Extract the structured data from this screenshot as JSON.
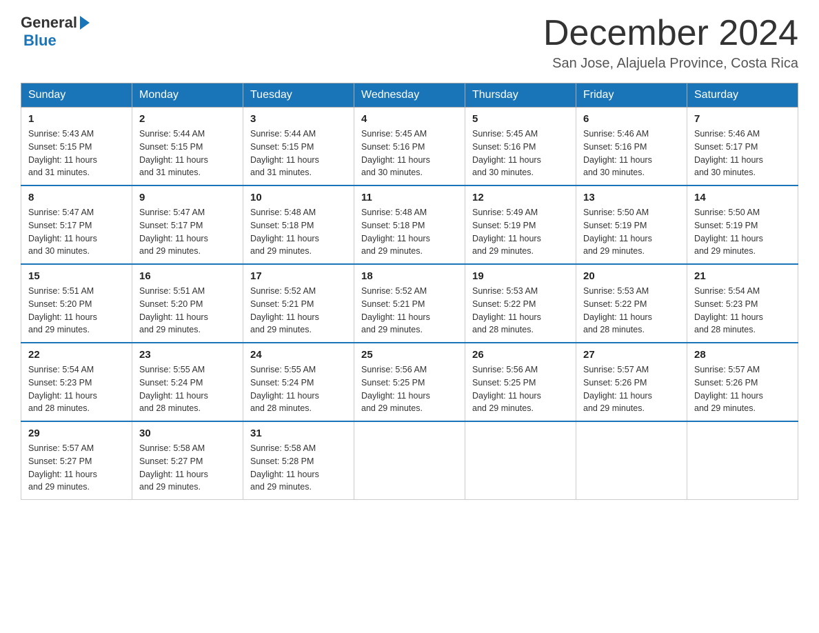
{
  "logo": {
    "general": "General",
    "blue": "Blue"
  },
  "title": "December 2024",
  "location": "San Jose, Alajuela Province, Costa Rica",
  "days_of_week": [
    "Sunday",
    "Monday",
    "Tuesday",
    "Wednesday",
    "Thursday",
    "Friday",
    "Saturday"
  ],
  "weeks": [
    [
      {
        "day": "1",
        "sunrise": "5:43 AM",
        "sunset": "5:15 PM",
        "daylight": "11 hours and 31 minutes."
      },
      {
        "day": "2",
        "sunrise": "5:44 AM",
        "sunset": "5:15 PM",
        "daylight": "11 hours and 31 minutes."
      },
      {
        "day": "3",
        "sunrise": "5:44 AM",
        "sunset": "5:15 PM",
        "daylight": "11 hours and 31 minutes."
      },
      {
        "day": "4",
        "sunrise": "5:45 AM",
        "sunset": "5:16 PM",
        "daylight": "11 hours and 30 minutes."
      },
      {
        "day": "5",
        "sunrise": "5:45 AM",
        "sunset": "5:16 PM",
        "daylight": "11 hours and 30 minutes."
      },
      {
        "day": "6",
        "sunrise": "5:46 AM",
        "sunset": "5:16 PM",
        "daylight": "11 hours and 30 minutes."
      },
      {
        "day": "7",
        "sunrise": "5:46 AM",
        "sunset": "5:17 PM",
        "daylight": "11 hours and 30 minutes."
      }
    ],
    [
      {
        "day": "8",
        "sunrise": "5:47 AM",
        "sunset": "5:17 PM",
        "daylight": "11 hours and 30 minutes."
      },
      {
        "day": "9",
        "sunrise": "5:47 AM",
        "sunset": "5:17 PM",
        "daylight": "11 hours and 29 minutes."
      },
      {
        "day": "10",
        "sunrise": "5:48 AM",
        "sunset": "5:18 PM",
        "daylight": "11 hours and 29 minutes."
      },
      {
        "day": "11",
        "sunrise": "5:48 AM",
        "sunset": "5:18 PM",
        "daylight": "11 hours and 29 minutes."
      },
      {
        "day": "12",
        "sunrise": "5:49 AM",
        "sunset": "5:19 PM",
        "daylight": "11 hours and 29 minutes."
      },
      {
        "day": "13",
        "sunrise": "5:50 AM",
        "sunset": "5:19 PM",
        "daylight": "11 hours and 29 minutes."
      },
      {
        "day": "14",
        "sunrise": "5:50 AM",
        "sunset": "5:19 PM",
        "daylight": "11 hours and 29 minutes."
      }
    ],
    [
      {
        "day": "15",
        "sunrise": "5:51 AM",
        "sunset": "5:20 PM",
        "daylight": "11 hours and 29 minutes."
      },
      {
        "day": "16",
        "sunrise": "5:51 AM",
        "sunset": "5:20 PM",
        "daylight": "11 hours and 29 minutes."
      },
      {
        "day": "17",
        "sunrise": "5:52 AM",
        "sunset": "5:21 PM",
        "daylight": "11 hours and 29 minutes."
      },
      {
        "day": "18",
        "sunrise": "5:52 AM",
        "sunset": "5:21 PM",
        "daylight": "11 hours and 29 minutes."
      },
      {
        "day": "19",
        "sunrise": "5:53 AM",
        "sunset": "5:22 PM",
        "daylight": "11 hours and 28 minutes."
      },
      {
        "day": "20",
        "sunrise": "5:53 AM",
        "sunset": "5:22 PM",
        "daylight": "11 hours and 28 minutes."
      },
      {
        "day": "21",
        "sunrise": "5:54 AM",
        "sunset": "5:23 PM",
        "daylight": "11 hours and 28 minutes."
      }
    ],
    [
      {
        "day": "22",
        "sunrise": "5:54 AM",
        "sunset": "5:23 PM",
        "daylight": "11 hours and 28 minutes."
      },
      {
        "day": "23",
        "sunrise": "5:55 AM",
        "sunset": "5:24 PM",
        "daylight": "11 hours and 28 minutes."
      },
      {
        "day": "24",
        "sunrise": "5:55 AM",
        "sunset": "5:24 PM",
        "daylight": "11 hours and 28 minutes."
      },
      {
        "day": "25",
        "sunrise": "5:56 AM",
        "sunset": "5:25 PM",
        "daylight": "11 hours and 29 minutes."
      },
      {
        "day": "26",
        "sunrise": "5:56 AM",
        "sunset": "5:25 PM",
        "daylight": "11 hours and 29 minutes."
      },
      {
        "day": "27",
        "sunrise": "5:57 AM",
        "sunset": "5:26 PM",
        "daylight": "11 hours and 29 minutes."
      },
      {
        "day": "28",
        "sunrise": "5:57 AM",
        "sunset": "5:26 PM",
        "daylight": "11 hours and 29 minutes."
      }
    ],
    [
      {
        "day": "29",
        "sunrise": "5:57 AM",
        "sunset": "5:27 PM",
        "daylight": "11 hours and 29 minutes."
      },
      {
        "day": "30",
        "sunrise": "5:58 AM",
        "sunset": "5:27 PM",
        "daylight": "11 hours and 29 minutes."
      },
      {
        "day": "31",
        "sunrise": "5:58 AM",
        "sunset": "5:28 PM",
        "daylight": "11 hours and 29 minutes."
      },
      null,
      null,
      null,
      null
    ]
  ],
  "labels": {
    "sunrise": "Sunrise:",
    "sunset": "Sunset:",
    "daylight": "Daylight:"
  }
}
